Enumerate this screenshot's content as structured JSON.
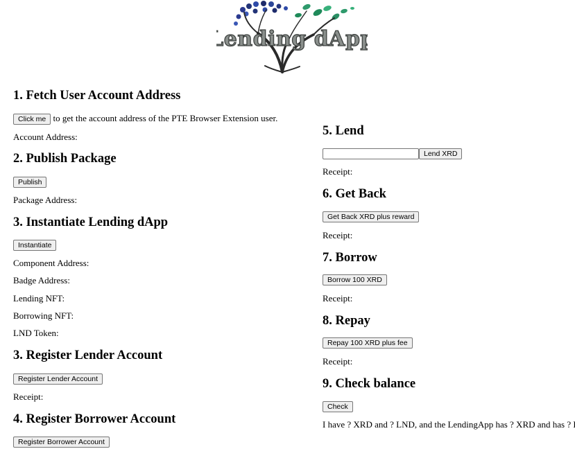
{
  "logo": {
    "text": "Lending dApp"
  },
  "left": {
    "s1": {
      "title": "1. Fetch User Account Address",
      "button": "Click me",
      "desc": " to get the account address of the PTE Browser Extension user.",
      "result": "Account Address:"
    },
    "s2": {
      "title": "2. Publish Package",
      "button": "Publish",
      "result": "Package Address:"
    },
    "s3": {
      "title": "3. Instantiate Lending dApp",
      "button": "Instantiate",
      "component": "Component Address:",
      "badge": "Badge Address:",
      "lending_nft": "Lending NFT:",
      "borrowing_nft": "Borrowing NFT:",
      "lnd_token": "LND Token:"
    },
    "s3b": {
      "title": "3. Register Lender Account",
      "button": "Register Lender Account",
      "receipt": "Receipt:"
    },
    "s4": {
      "title": "4. Register Borrower Account",
      "button": "Register Borrower Account"
    }
  },
  "right": {
    "s5": {
      "title": "5. Lend",
      "input_value": "",
      "button": "Lend XRD",
      "receipt": "Receipt:"
    },
    "s6": {
      "title": "6. Get Back",
      "button": "Get Back XRD plus reward",
      "receipt": "Receipt:"
    },
    "s7": {
      "title": "7. Borrow",
      "button": "Borrow 100 XRD",
      "receipt": "Receipt:"
    },
    "s8": {
      "title": "8. Repay",
      "button": "Repay 100 XRD plus fee",
      "receipt": "Receipt:"
    },
    "s9": {
      "title": "9. Check balance",
      "button": "Check",
      "result": "I have ? XRD and ? LND, and the LendingApp has ? XRD and has ? LND."
    }
  }
}
